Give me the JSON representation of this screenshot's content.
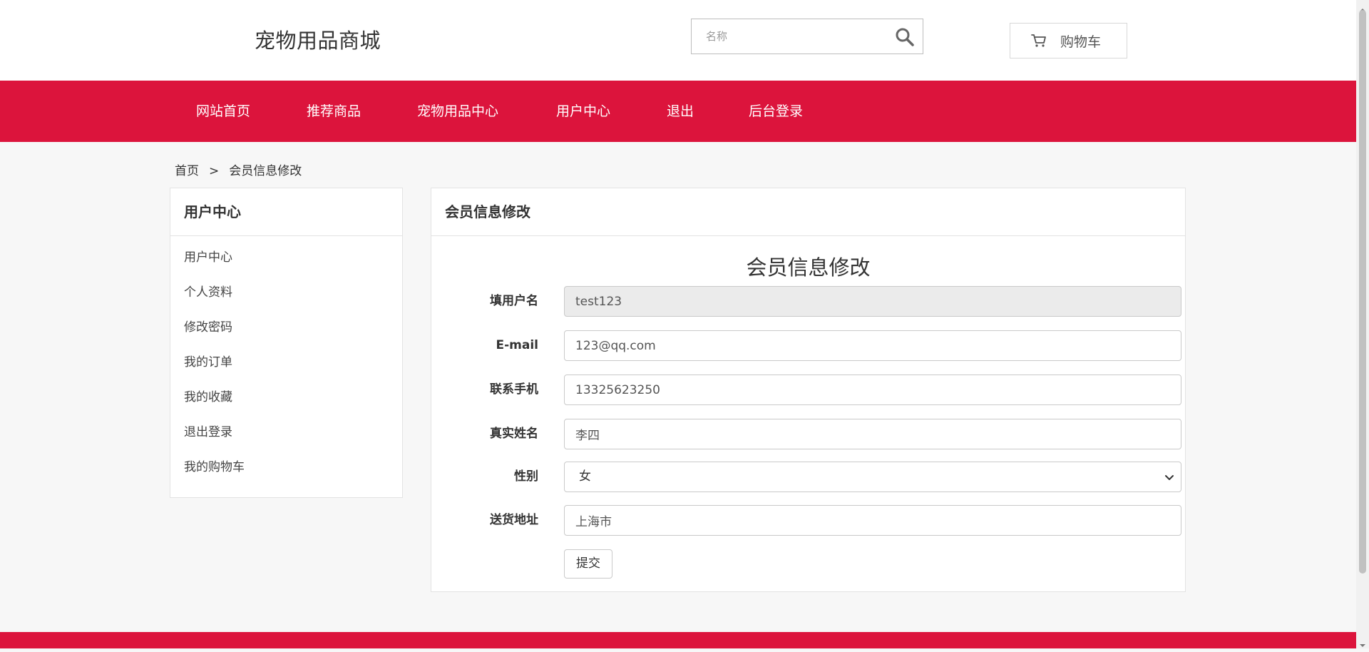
{
  "header": {
    "site_title": "宠物用品商城",
    "search_placeholder": "名称",
    "cart_label": "购物车"
  },
  "nav": {
    "items": [
      "网站首页",
      "推荐商品",
      "宠物用品中心",
      "用户中心",
      "退出",
      "后台登录"
    ]
  },
  "breadcrumb": {
    "home": "首页",
    "separator": ">",
    "current": "会员信息修改"
  },
  "sidebar": {
    "title": "用户中心",
    "items": [
      "用户中心",
      "个人资料",
      "修改密码",
      "我的订单",
      "我的收藏",
      "退出登录",
      "我的购物车"
    ]
  },
  "main": {
    "panel_title": "会员信息修改",
    "form_title": "会员信息修改",
    "fields": {
      "username": {
        "label": "填用户名",
        "value": "test123"
      },
      "email": {
        "label": "E-mail",
        "value": "123@qq.com"
      },
      "phone": {
        "label": "联系手机",
        "value": "13325623250"
      },
      "realname": {
        "label": "真实姓名",
        "value": "李四"
      },
      "gender": {
        "label": "性别",
        "value": "女"
      },
      "address": {
        "label": "送货地址",
        "value": "上海市"
      }
    },
    "submit_label": "提交"
  },
  "colors": {
    "brand": "#dc143c",
    "background": "#f7f7f7",
    "panel": "#ffffff"
  }
}
